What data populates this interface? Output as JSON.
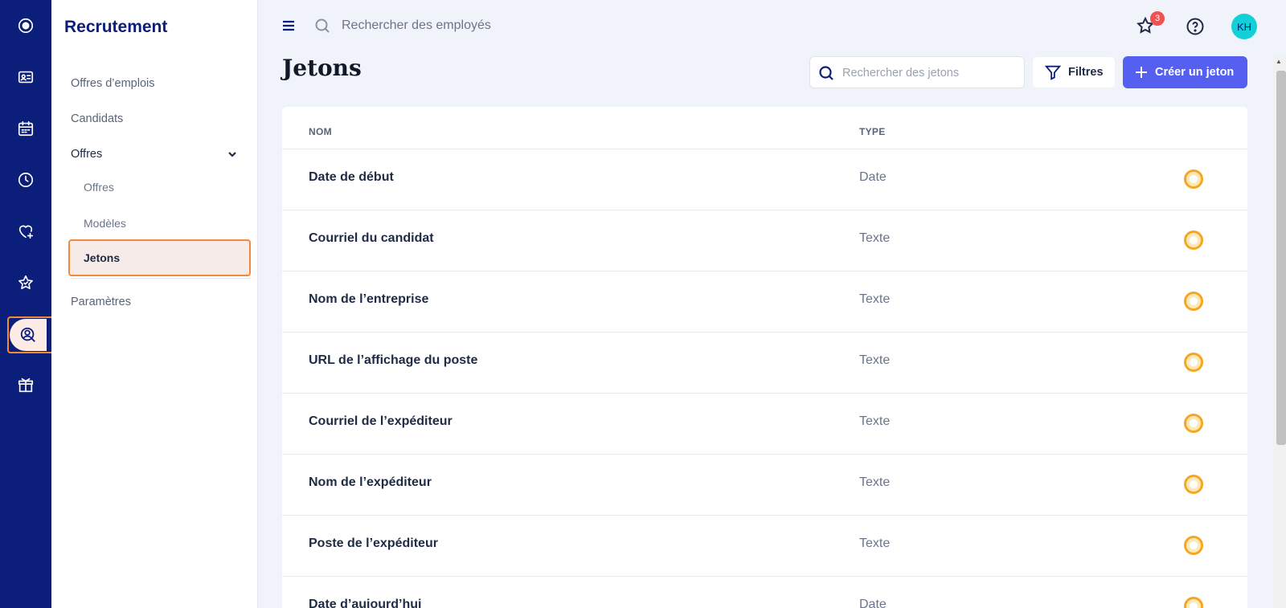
{
  "rail": {
    "items": [
      {
        "icon": "logo-icon"
      },
      {
        "icon": "id-card-icon"
      },
      {
        "icon": "calendar-icon"
      },
      {
        "icon": "clock-icon"
      },
      {
        "icon": "heart-plus-icon"
      },
      {
        "icon": "star-icon"
      },
      {
        "icon": "user-search-icon",
        "active": true
      },
      {
        "icon": "gift-box-icon"
      }
    ]
  },
  "sidebar": {
    "title": "Recrutement",
    "items": {
      "job_offers": "Offres d’emplois",
      "candidates": "Candidats",
      "offers_group": "Offres",
      "offers": "Offres",
      "templates": "Modèles",
      "tokens": "Jetons",
      "settings": "Paramètres"
    }
  },
  "topbar": {
    "search_placeholder": "Rechercher des employés",
    "notification_count": "3",
    "avatar_initials": "KH"
  },
  "page": {
    "title": "Jetons",
    "search_placeholder": "Rechercher des jetons",
    "filters_label": "Filtres",
    "create_label": "Créer un jeton"
  },
  "table": {
    "headers": {
      "name": "NOM",
      "type": "TYPE"
    },
    "rows": [
      {
        "name": "Date de début",
        "type": "Date"
      },
      {
        "name": "Courriel du candidat",
        "type": "Texte"
      },
      {
        "name": "Nom de l’entreprise",
        "type": "Texte"
      },
      {
        "name": "URL de l’affichage du poste",
        "type": "Texte"
      },
      {
        "name": "Courriel de l’expéditeur",
        "type": "Texte"
      },
      {
        "name": "Nom de l’expéditeur",
        "type": "Texte"
      },
      {
        "name": "Poste de l’expéditeur",
        "type": "Texte"
      },
      {
        "name": "Date d’aujourd’hui",
        "type": "Date"
      }
    ]
  },
  "colors": {
    "rail": "#0b1f7a",
    "primary_button": "#5560f0",
    "highlight_border": "#f28a3a",
    "status_ring": "#f5a623",
    "badge": "#f05252",
    "avatar": "#13cfd8"
  }
}
